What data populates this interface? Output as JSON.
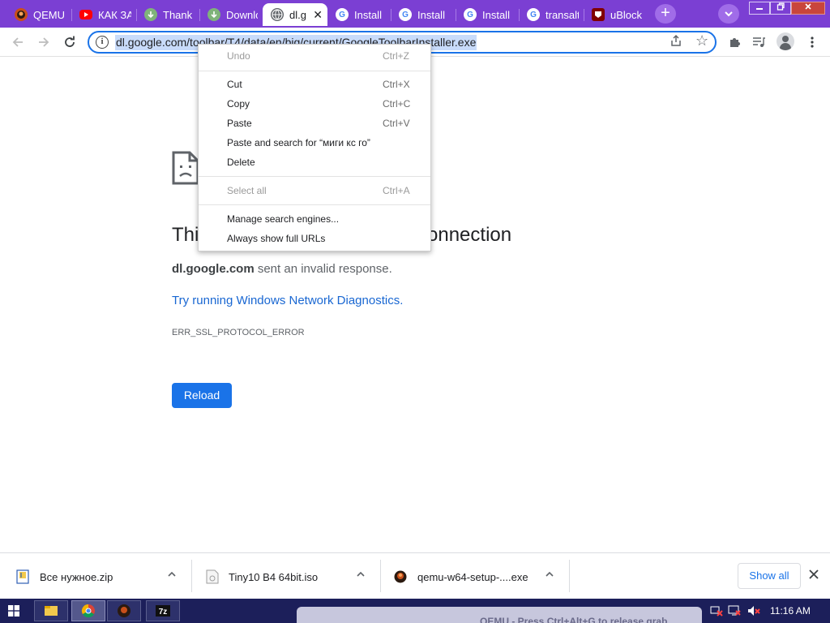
{
  "browser": {
    "tabs": [
      {
        "title": "QEMU",
        "icon": "qemu-icon",
        "active": false
      },
      {
        "title": "КАК ЗА",
        "icon": "youtube-icon",
        "active": false
      },
      {
        "title": "Thank",
        "icon": "download-site-icon",
        "active": false
      },
      {
        "title": "Downlo",
        "icon": "download-site-icon",
        "active": false
      },
      {
        "title": "dl.g",
        "icon": "globe-icon",
        "active": true
      },
      {
        "title": "Install",
        "icon": "google-icon",
        "active": false
      },
      {
        "title": "Install",
        "icon": "google-icon",
        "active": false
      },
      {
        "title": "Install",
        "icon": "google-icon",
        "active": false
      },
      {
        "title": "transalt",
        "icon": "google-icon",
        "active": false
      },
      {
        "title": "uBlock",
        "icon": "ublock-icon",
        "active": false
      }
    ],
    "new_tab_label": "+",
    "tab_search_label": "⌄",
    "url": "dl.google.com/toolbar/T4/data/en/big/current/GoogleToolbarInstaller.exe"
  },
  "context_menu": {
    "groups": [
      [
        {
          "label": "Undo",
          "shortcut": "Ctrl+Z",
          "enabled": false
        }
      ],
      [
        {
          "label": "Cut",
          "shortcut": "Ctrl+X",
          "enabled": true
        },
        {
          "label": "Copy",
          "shortcut": "Ctrl+C",
          "enabled": true
        },
        {
          "label": "Paste",
          "shortcut": "Ctrl+V",
          "enabled": true
        },
        {
          "label": "Paste and search for “миги кс го”",
          "shortcut": "",
          "enabled": true
        },
        {
          "label": "Delete",
          "shortcut": "",
          "enabled": true
        }
      ],
      [
        {
          "label": "Select all",
          "shortcut": "Ctrl+A",
          "enabled": false
        }
      ],
      [
        {
          "label": "Manage search engines...",
          "shortcut": "",
          "enabled": true
        },
        {
          "label": "Always show full URLs",
          "shortcut": "",
          "enabled": true
        }
      ]
    ]
  },
  "error_page": {
    "title_start": "Thi",
    "title_end": "e connection",
    "host": "dl.google.com",
    "message": " sent an invalid response.",
    "diagnostics_link": "Try running Windows Network Diagnostics.",
    "error_code": "ERR_SSL_PROTOCOL_ERROR",
    "reload_label": "Reload"
  },
  "downloads": {
    "items": [
      {
        "name": "Все нужное.zip",
        "icon": "zip-file-icon"
      },
      {
        "name": "Tiny10 B4 64bit.iso",
        "icon": "iso-file-icon"
      },
      {
        "name": "qemu-w64-setup-....exe",
        "icon": "qemu-icon"
      }
    ],
    "show_all_label": "Show all"
  },
  "taskbar": {
    "notice": "QEMU - Press Ctrl+Alt+G to release grab",
    "clock": "11:16 AM",
    "apps": [
      "file-explorer-icon",
      "chrome-icon",
      "qemu-icon",
      "7zip-icon"
    ]
  },
  "colors": {
    "tabstrip": "#7b3fd3",
    "accent": "#1a73e8",
    "url_selection": "#c8dbfa",
    "taskbar": "#1c1f5a"
  }
}
